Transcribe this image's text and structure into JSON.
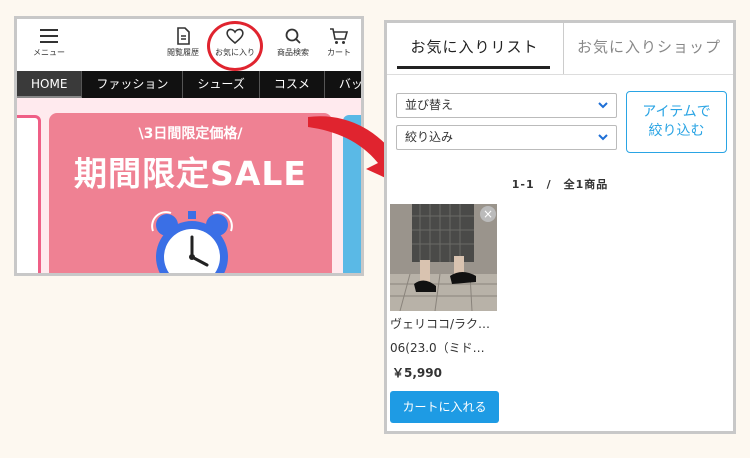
{
  "phone": {
    "header": [
      {
        "label": "メニュー",
        "icon": "hamburger-icon"
      },
      {
        "label": "閲覧履歴",
        "icon": "document-icon"
      },
      {
        "label": "お気に入り",
        "icon": "heart-icon"
      },
      {
        "label": "商品検索",
        "icon": "search-icon"
      },
      {
        "label": "カート",
        "icon": "cart-icon"
      }
    ],
    "nav": [
      "HOME",
      "ファッション",
      "シューズ",
      "コスメ",
      "バッグ・財"
    ],
    "banner": {
      "sub": "\\3日間限定価格/",
      "title": "期間限定SALE"
    }
  },
  "favorites": {
    "tabs": [
      "お気に入りリスト",
      "お気に入りショップ"
    ],
    "sort_label": "並び替え",
    "filter_label": "絞り込み",
    "filter_button": [
      "アイテムで",
      "絞り込む"
    ],
    "count": "1-1　/　全1商品",
    "item": {
      "name_line1": "ヴェリココ/ラク…",
      "name_line2": "06(23.0（ミド…",
      "price": "￥5,990",
      "remove": "×",
      "cart_button": "カートに入れる"
    }
  },
  "colors": {
    "accent_red": "#e0242f",
    "banner_pink": "#ef8193",
    "cart_blue": "#1e9be4"
  }
}
